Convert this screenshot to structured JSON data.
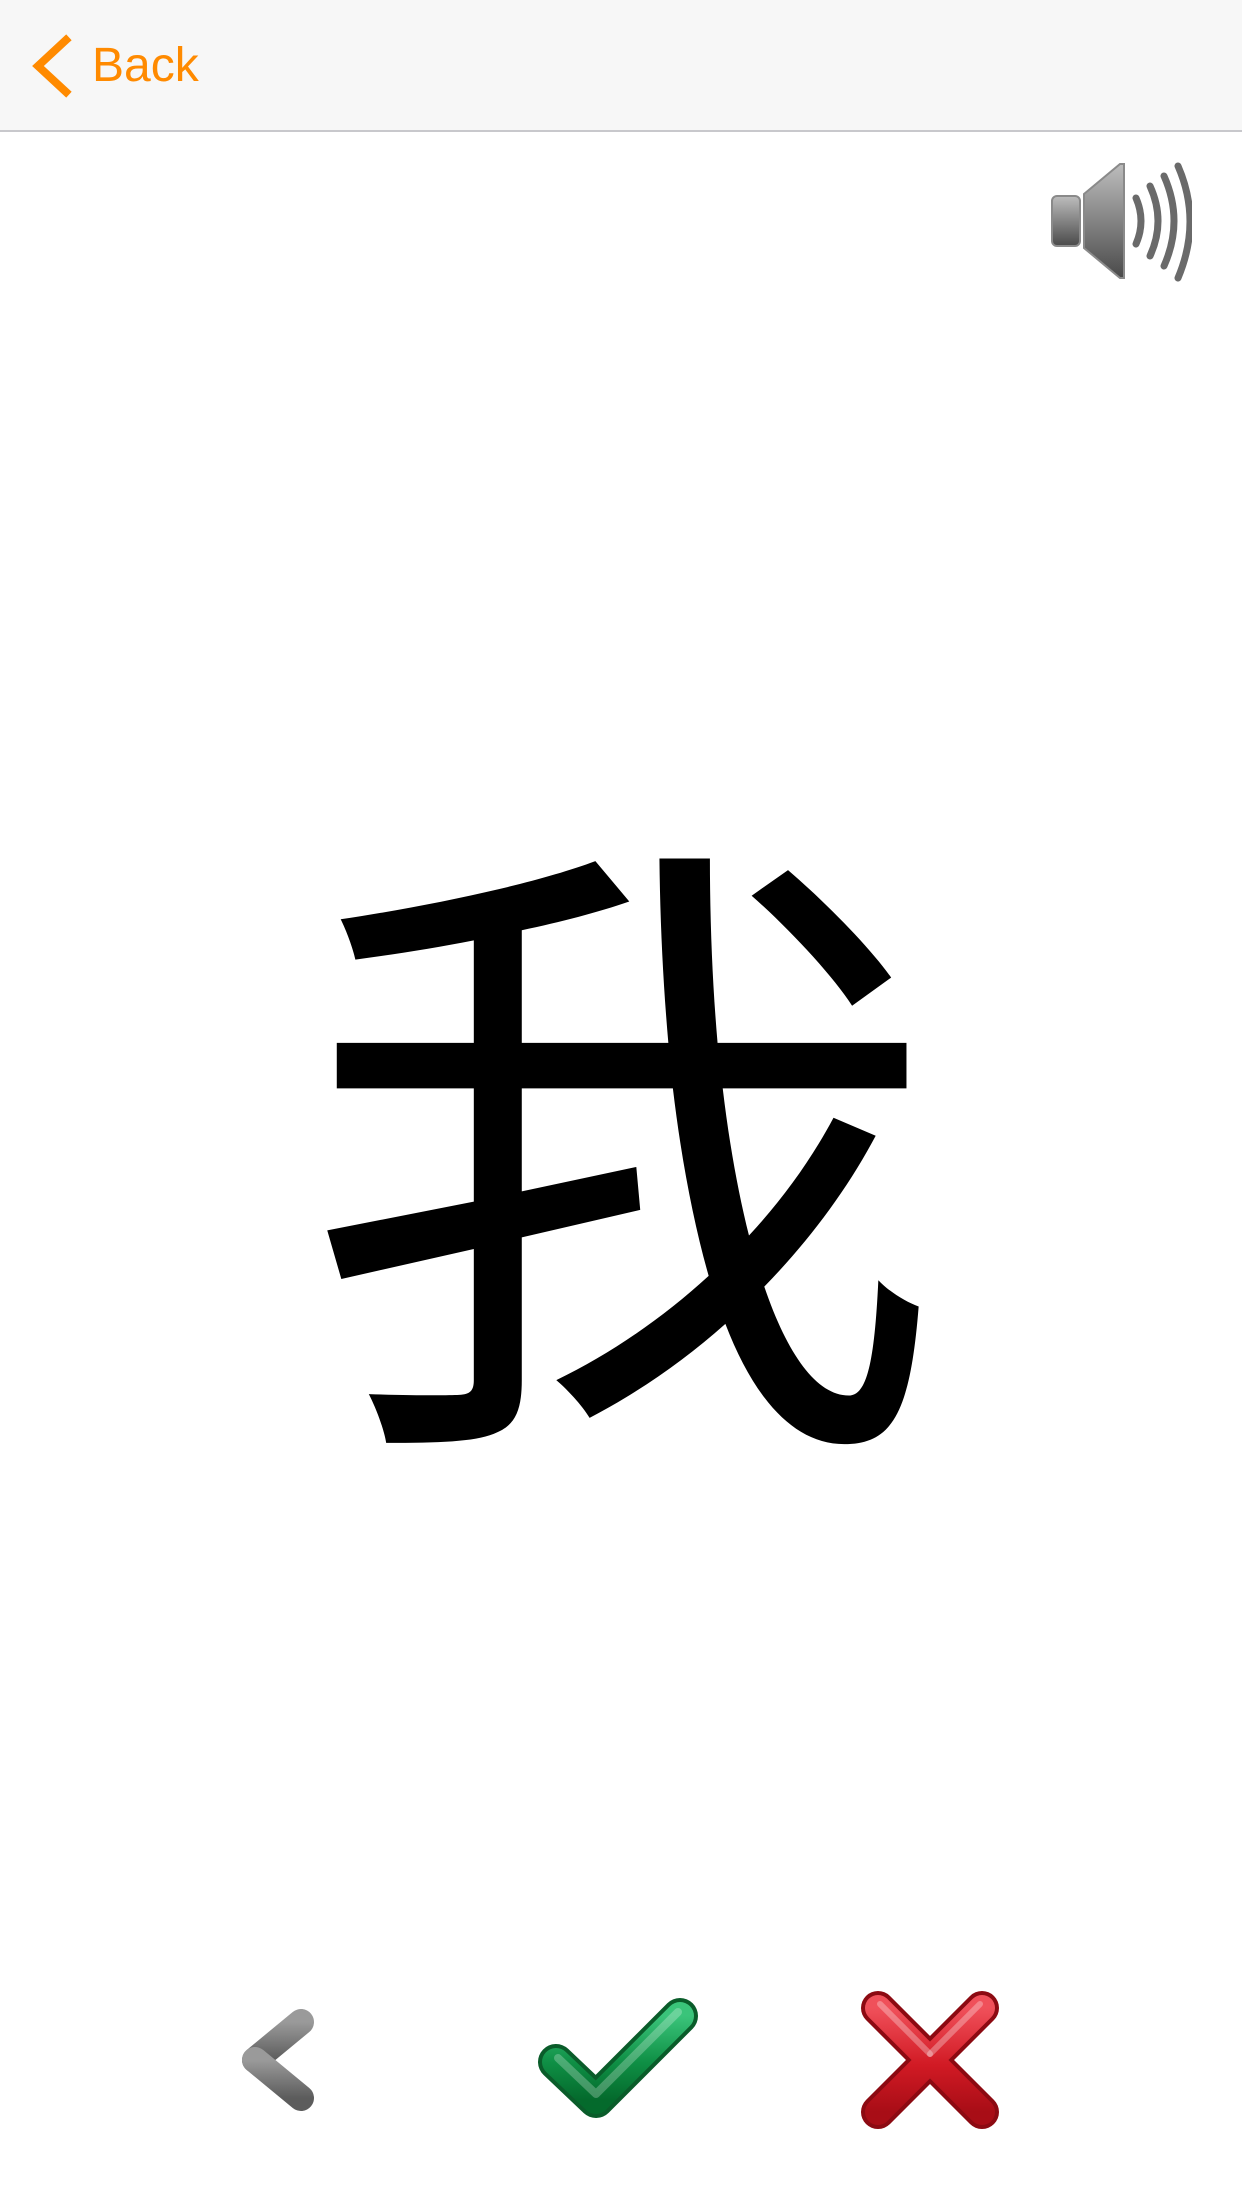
{
  "nav": {
    "back_label": "Back",
    "accent_color": "#ff8a00"
  },
  "flashcard": {
    "character": "我"
  },
  "icons": {
    "back": "chevron-left-icon",
    "audio": "speaker-icon",
    "previous": "arrow-left-icon",
    "correct": "checkmark-icon",
    "wrong": "cross-icon"
  },
  "colors": {
    "previous": "#6f6f6f",
    "correct": "#0a7a3a",
    "wrong": "#d11a24"
  }
}
